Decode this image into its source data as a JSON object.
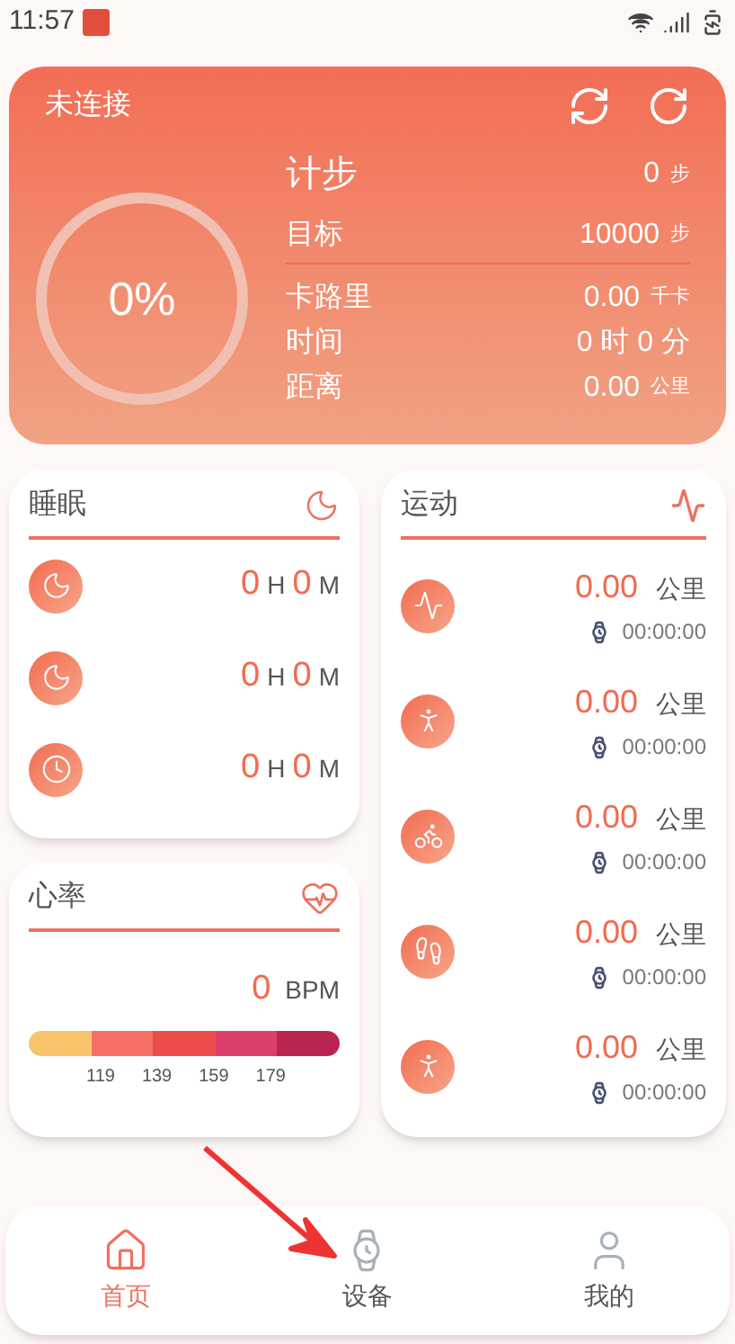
{
  "status_bar": {
    "time": "11:57"
  },
  "summary": {
    "connection": "未连接",
    "progress": {
      "level": 0,
      "label": "0%"
    },
    "rows": [
      {
        "kind": "main",
        "label": "计步",
        "value": "0",
        "unit": "步"
      },
      {
        "kind": "goal",
        "label": "目标",
        "value": "10000",
        "unit": "步"
      },
      {
        "kind": "stat",
        "label": "卡路里",
        "value": "0.00",
        "unit": "千卡"
      },
      {
        "kind": "stat",
        "label": "时间",
        "value": "0 时 0 分",
        "unit": ""
      },
      {
        "kind": "stat",
        "label": "距离",
        "value": "0.00",
        "unit": "公里"
      }
    ]
  },
  "sleep": {
    "title": "睡眠",
    "rows": [
      {
        "kind": "deep",
        "hours": "0",
        "h": "H",
        "minutes": "0",
        "m": "M"
      },
      {
        "kind": "light",
        "hours": "0",
        "h": "H",
        "minutes": "0",
        "m": "M"
      },
      {
        "kind": "awake",
        "hours": "0",
        "h": "H",
        "minutes": "0",
        "m": "M"
      }
    ]
  },
  "heart_rate": {
    "title": "心率",
    "value": "0",
    "unit": "BPM",
    "zones": [
      {
        "color": "#f7c46c"
      },
      {
        "color": "#f66f66"
      },
      {
        "color": "#ee4b4b"
      },
      {
        "color": "#dc3f6c"
      },
      {
        "color": "#b92550"
      }
    ],
    "ticks": [
      "119",
      "139",
      "159",
      "179"
    ]
  },
  "sport": {
    "title": "运动",
    "rows": [
      {
        "kind": "run",
        "distance": "0.00",
        "unit": "公里",
        "duration": "00:00:00"
      },
      {
        "kind": "walk",
        "distance": "0.00",
        "unit": "公里",
        "duration": "00:00:00"
      },
      {
        "kind": "cycle",
        "distance": "0.00",
        "unit": "公里",
        "duration": "00:00:00"
      },
      {
        "kind": "hike",
        "distance": "0.00",
        "unit": "公里",
        "duration": "00:00:00"
      },
      {
        "kind": "treadmill",
        "distance": "0.00",
        "unit": "公里",
        "duration": "00:00:00"
      }
    ]
  },
  "nav": [
    {
      "kind": "home",
      "label": "首页",
      "selected": true
    },
    {
      "kind": "device",
      "label": "设备",
      "selected": false
    },
    {
      "kind": "me",
      "label": "我的",
      "selected": false
    }
  ]
}
